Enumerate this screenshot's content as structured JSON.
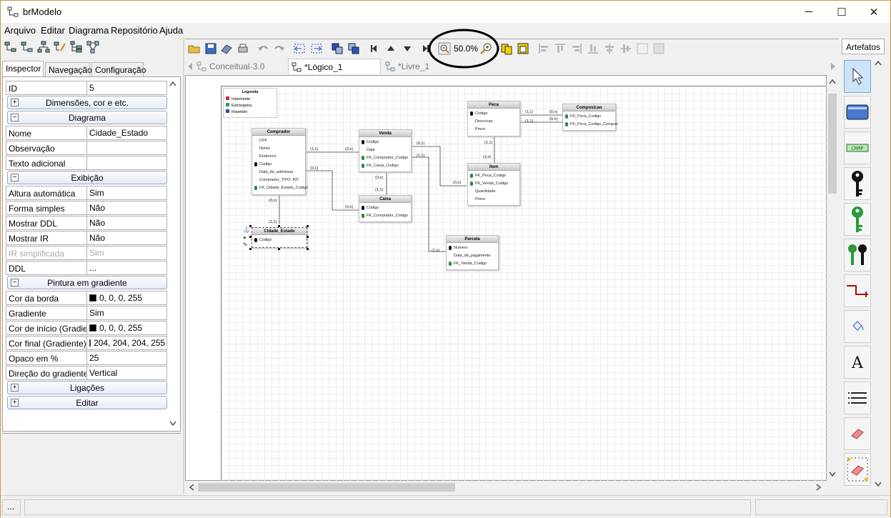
{
  "window": {
    "title": "brModelo",
    "minimize": "─",
    "maximize": "☐",
    "close": "✕"
  },
  "menu": [
    "Arquivo",
    "Editar",
    "Diagrama",
    "Repositório",
    "Ajuda"
  ],
  "left_tabs": [
    "Inspector",
    "Navegação",
    "Configuração"
  ],
  "inspector": {
    "id": {
      "label": "ID",
      "value": "5"
    },
    "grp_dimensoes": "Dimensões, cor e etc.",
    "grp_diagrama": "Diagrama",
    "nome": {
      "label": "Nome",
      "value": "Cidade_Estado"
    },
    "observacao": {
      "label": "Observação",
      "value": ""
    },
    "texto_adicional": {
      "label": "Texto adicional",
      "value": ""
    },
    "grp_exibicao": "Exibição",
    "altura": {
      "label": "Altura automática",
      "value": "Sim"
    },
    "forma": {
      "label": "Forma simples",
      "value": "Não"
    },
    "ddl_show": {
      "label": "Mostrar DDL",
      "value": "Não"
    },
    "ir_show": {
      "label": "Mostrar IR",
      "value": "Não"
    },
    "ir_simpl": {
      "label": "IR simplificada",
      "value": "Sim"
    },
    "ddl": {
      "label": "DDL",
      "value": "..."
    },
    "grp_pintura": "Pintura em gradiente",
    "cor_borda": {
      "label": "Cor da borda",
      "value": "0, 0, 0, 255",
      "color": "#000000"
    },
    "gradiente": {
      "label": "Gradiente",
      "value": "Sim"
    },
    "cor_inicio": {
      "label": "Cor de início (Gradiente)",
      "value": "0, 0, 0, 255",
      "color": "#000000"
    },
    "cor_final": {
      "label": "Cor final (Gradiente)",
      "value": "204, 204, 204, 255",
      "color": "#cccccc"
    },
    "opaco": {
      "label": "Opaco em %",
      "value": "25"
    },
    "direcao": {
      "label": "Direção do gradiente",
      "value": "Vertical"
    },
    "grp_ligacoes": "Ligações",
    "grp_editar": "Editar"
  },
  "toolbar": {
    "zoom": "50.0%"
  },
  "doc_tabs": [
    "Conceitual-3.0",
    "*Lógico_1",
    "*Livre_1"
  ],
  "artefatos": {
    "title": "Artefatos"
  },
  "status": {
    "left": "..."
  },
  "diagram": {
    "legend": {
      "title": "Legenda",
      "items": [
        "Importante",
        "Estrangeira",
        "Repetido"
      ]
    },
    "comprador": {
      "name": "Comprador",
      "attrs": [
        "CPF",
        "Nome",
        "Endereco",
        "Codigo",
        "Data_de_admissao",
        "Comprador_TIPO: INT",
        "FK_Cidade_Estado_Codigo"
      ]
    },
    "venda": {
      "name": "Venda",
      "attrs": [
        "Codigo",
        "Data",
        "FK_Comprador_Codigo",
        "FK_Caixa_Codigo"
      ]
    },
    "caixa": {
      "name": "Caixa",
      "attrs": [
        "Codigo",
        "FK_Comprador_Codigo"
      ]
    },
    "cidade": {
      "name": "Cidade_Estado",
      "attrs": [
        "Codigo"
      ]
    },
    "peca": {
      "name": "Peca",
      "attrs": [
        "Codigo",
        "Descricao",
        "Preco"
      ]
    },
    "composicao": {
      "name": "Composicao",
      "attrs": [
        "FK_Peca_Codigo",
        "FK_Peca_Codigo_Compos"
      ]
    },
    "item": {
      "name": "Item",
      "attrs": [
        "FK_Peca_Codigo",
        "FK_Venda_Codigo",
        "Quantidade",
        "Preco"
      ]
    },
    "parcela": {
      "name": "Parcela",
      "attrs": [
        "Numero",
        "Data_de_pagamento",
        "FK_Venda_Codigo"
      ]
    },
    "cards": {
      "c_venda_1": "(1,1)",
      "c_venda_2": "(0,n)",
      "c_caixa_1": "(0,1)",
      "c_caixa_2": "(0,n)",
      "c_cid_1": "(0,n)",
      "c_cid_2": "(1,1)",
      "c_vc_1": "(0,n)",
      "c_vc_2": "(1,1)",
      "c_vi_1": "(0,1)",
      "c_vi_2": "(0,n)",
      "c_vp_1": "(1,1)",
      "c_vp_2": "(1,n)",
      "c_pi_1": "(1,1)",
      "c_pi_2": "(1,n)",
      "c_pc_1": "(1,1)",
      "c_pc_2": "(0,n)",
      "c_pc_3": "(1,1)",
      "c_pc_4": "(0,n)"
    }
  }
}
